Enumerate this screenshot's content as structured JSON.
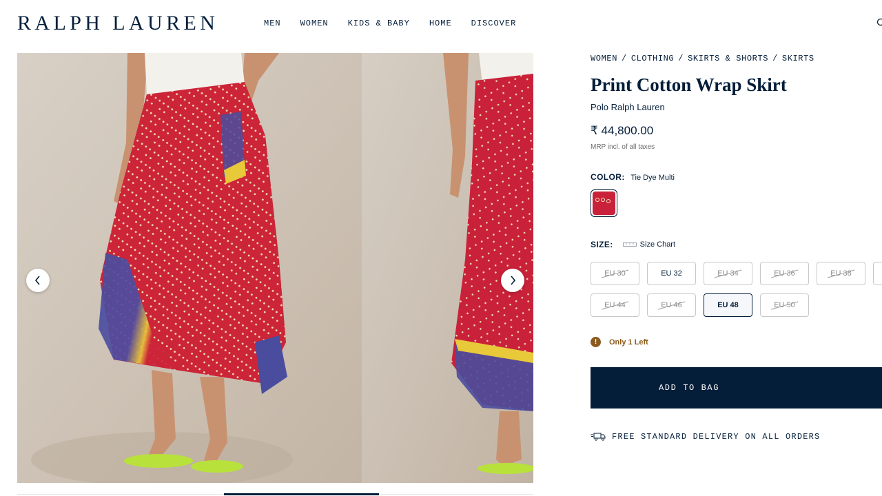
{
  "header": {
    "logo": "RALPH LAUREN",
    "nav": [
      "MEN",
      "WOMEN",
      "KIDS & BABY",
      "HOME",
      "DISCOVER"
    ]
  },
  "breadcrumb": [
    "WOMEN",
    "CLOTHING",
    "SKIRTS & SHORTS",
    "SKIRTS"
  ],
  "product": {
    "title": "Print Cotton Wrap Skirt",
    "brand": "Polo Ralph Lauren",
    "price": "₹ 44,800.00",
    "price_note": "MRP incl. of all taxes",
    "color_label": "COLOR:",
    "color_value": "Tie Dye Multi",
    "size_label": "SIZE:",
    "size_chart_label": "Size Chart",
    "sizes": [
      {
        "label": "EU 30",
        "available": false
      },
      {
        "label": "EU 32",
        "available": true
      },
      {
        "label": "EU 34",
        "available": false
      },
      {
        "label": "EU 36",
        "available": false
      },
      {
        "label": "EU 38",
        "available": false
      },
      {
        "label": "EU 44",
        "available": false
      },
      {
        "label": "EU 46",
        "available": false
      },
      {
        "label": "EU 48",
        "available": true,
        "selected": true
      },
      {
        "label": "EU 50",
        "available": false
      }
    ],
    "stock_text": "Only 1 Left",
    "add_to_bag": "ADD TO BAG",
    "delivery_text": "FREE STANDARD DELIVERY ON ALL ORDERS"
  },
  "colors": {
    "navy": "#041e3a",
    "skirt_red": "#c9213a",
    "stock_brown": "#8a5a1e"
  },
  "icons": {
    "search": "search-icon",
    "prev": "chevron-left-icon",
    "next": "chevron-right-icon",
    "ruler": "ruler-icon",
    "alert": "alert-icon",
    "truck": "truck-icon"
  }
}
